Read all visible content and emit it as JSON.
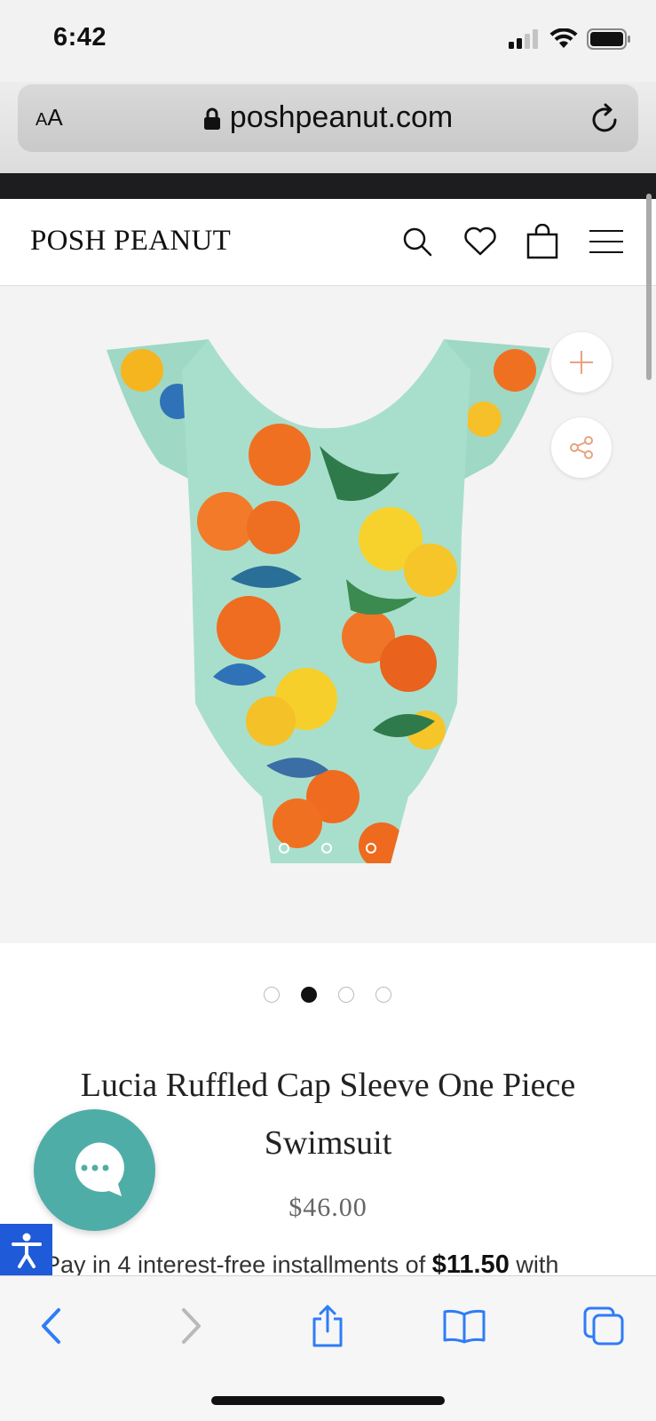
{
  "status_bar": {
    "time": "6:42"
  },
  "browser": {
    "text_size_small": "A",
    "text_size_large": "A",
    "url": "poshpeanut.com"
  },
  "site": {
    "brand": "POSH PEANUT"
  },
  "product": {
    "title": "Lucia Ruffled Cap Sleeve One Piece Swimsuit",
    "price": "$46.00",
    "installments_prefix": "Pay in 4 interest-free installments of",
    "installments_amount": "$11.50",
    "installments_suffix": "with",
    "gallery_total": 4,
    "gallery_active_index": 1
  },
  "colors": {
    "accent_teal": "#4fada7",
    "accent_orange": "#e8a280",
    "accessibility_blue": "#1f5ad8",
    "ios_blue": "#2f7cf6"
  },
  "icons": {
    "header": [
      "search-icon",
      "heart-icon",
      "bag-icon",
      "menu-icon"
    ],
    "gallery_actions": [
      "plus-icon",
      "share-icon"
    ],
    "toolbar": [
      "back-icon",
      "forward-icon",
      "share-icon",
      "bookmarks-icon",
      "tabs-icon"
    ]
  }
}
